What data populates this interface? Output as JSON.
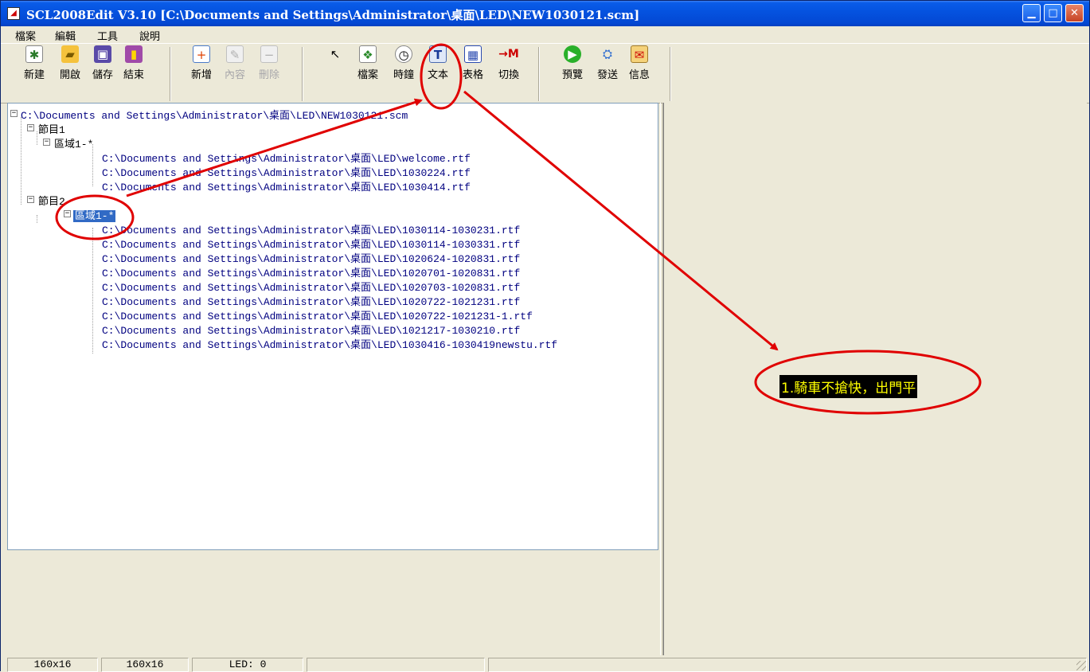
{
  "window": {
    "title": "SCL2008Edit V3.10 [C:\\Documents and Settings\\Administrator\\桌面\\LED\\NEW1030121.scm]"
  },
  "menubar": {
    "items": [
      "檔案",
      "編輯",
      "工具",
      "說明"
    ]
  },
  "toolbar": {
    "new_label": "新建",
    "open_label": "開啟",
    "save_label": "儲存",
    "exit_label": "結束",
    "add_label": "新增",
    "content_label": "內容",
    "delete_label": "刪除",
    "file_label": "檔案",
    "clock_label": "時鐘",
    "text_label": "文本",
    "table_label": "表格",
    "switch_label": "切換",
    "preview_label": "預覽",
    "send_label": "發送",
    "info_label": "信息"
  },
  "tree": {
    "root": "C:\\Documents and Settings\\Administrator\\桌面\\LED\\NEW1030121.scm",
    "program1": {
      "label": "節目1",
      "area": "區域1-*",
      "files": [
        "C:\\Documents and Settings\\Administrator\\桌面\\LED\\welcome.rtf",
        "C:\\Documents and Settings\\Administrator\\桌面\\LED\\1030224.rtf",
        "C:\\Documents and Settings\\Administrator\\桌面\\LED\\1030414.rtf"
      ]
    },
    "program2": {
      "label": "節目2",
      "area": "區域1-*",
      "files": [
        "C:\\Documents and Settings\\Administrator\\桌面\\LED\\1030114-1030231.rtf",
        "C:\\Documents and Settings\\Administrator\\桌面\\LED\\1030114-1030331.rtf",
        "C:\\Documents and Settings\\Administrator\\桌面\\LED\\1020624-1020831.rtf",
        "C:\\Documents and Settings\\Administrator\\桌面\\LED\\1020701-1020831.rtf",
        "C:\\Documents and Settings\\Administrator\\桌面\\LED\\1020703-1020831.rtf",
        "C:\\Documents and Settings\\Administrator\\桌面\\LED\\1020722-1021231.rtf",
        "C:\\Documents and Settings\\Administrator\\桌面\\LED\\1020722-1021231-1.rtf",
        "C:\\Documents and Settings\\Administrator\\桌面\\LED\\1021217-1030210.rtf",
        "C:\\Documents and Settings\\Administrator\\桌面\\LED\\1030416-1030419newstu.rtf"
      ]
    }
  },
  "preview": {
    "led_text": "1.騎車不搶快，出門平"
  },
  "statusbar": {
    "size1": "160x16",
    "size2": "160x16",
    "led": "LED: 0"
  },
  "colors": {
    "titlebar": "#0553e0",
    "tree_text": "#000080",
    "selection": "#316ac5",
    "led_bg": "#000000",
    "led_fg": "#ffff00",
    "annotation": "#e00000"
  }
}
